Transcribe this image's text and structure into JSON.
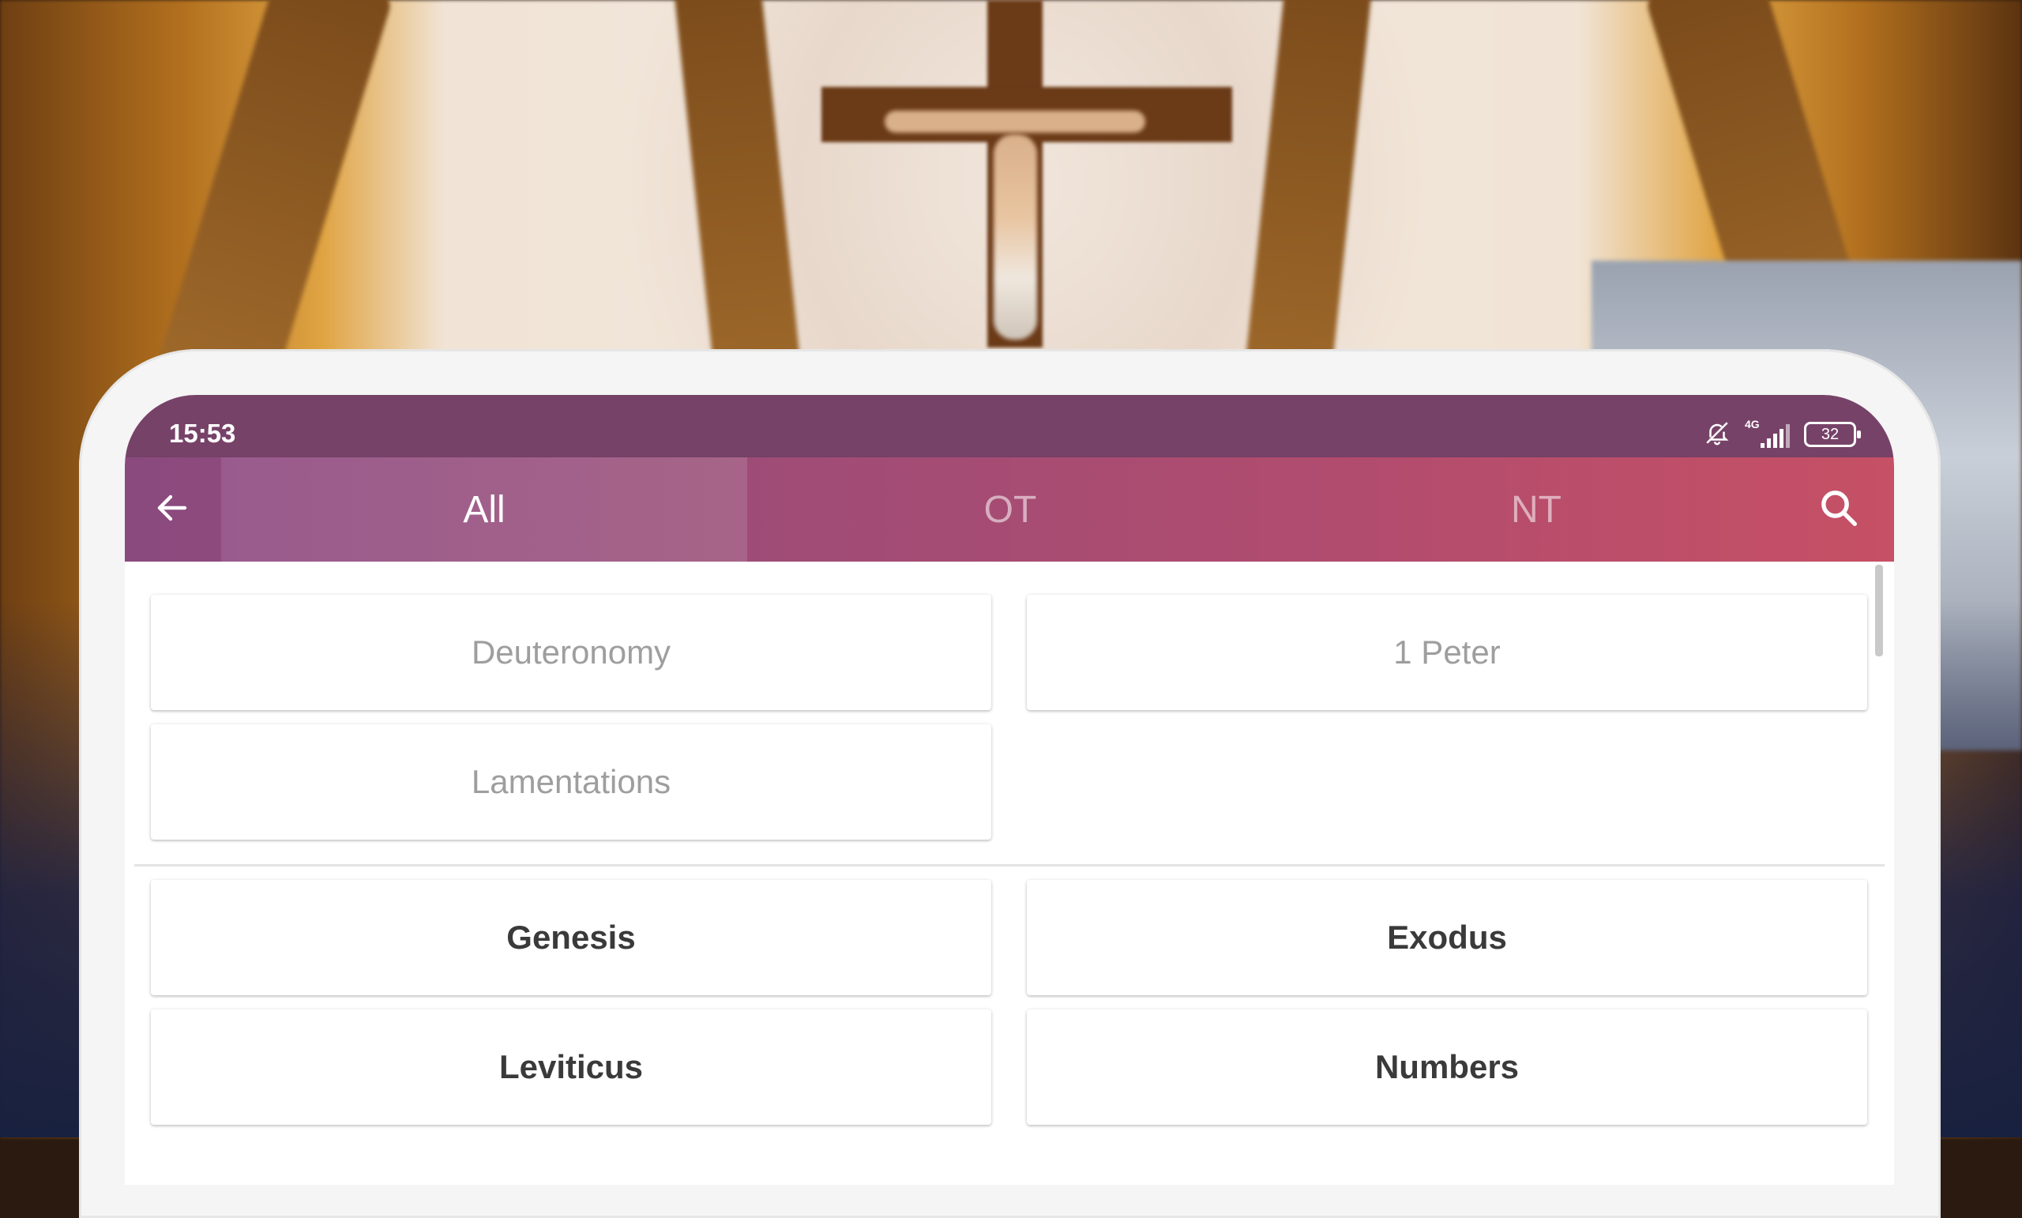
{
  "status_bar": {
    "time": "15:53",
    "network": "4G",
    "battery": "32"
  },
  "app_bar": {
    "tabs": [
      {
        "label": "All",
        "selected": true
      },
      {
        "label": "OT",
        "selected": false
      },
      {
        "label": "NT",
        "selected": false
      }
    ]
  },
  "recent_books": [
    {
      "label": "Deuteronomy"
    },
    {
      "label": "1 Peter"
    },
    {
      "label": "Lamentations"
    }
  ],
  "books": [
    {
      "label": "Genesis"
    },
    {
      "label": "Exodus"
    },
    {
      "label": "Leviticus"
    },
    {
      "label": "Numbers"
    }
  ],
  "colors": {
    "status_bar": "#774268",
    "app_bar_start": "#8a4a7e",
    "app_bar_end": "#c65065",
    "selected_tab": "#a76488"
  }
}
